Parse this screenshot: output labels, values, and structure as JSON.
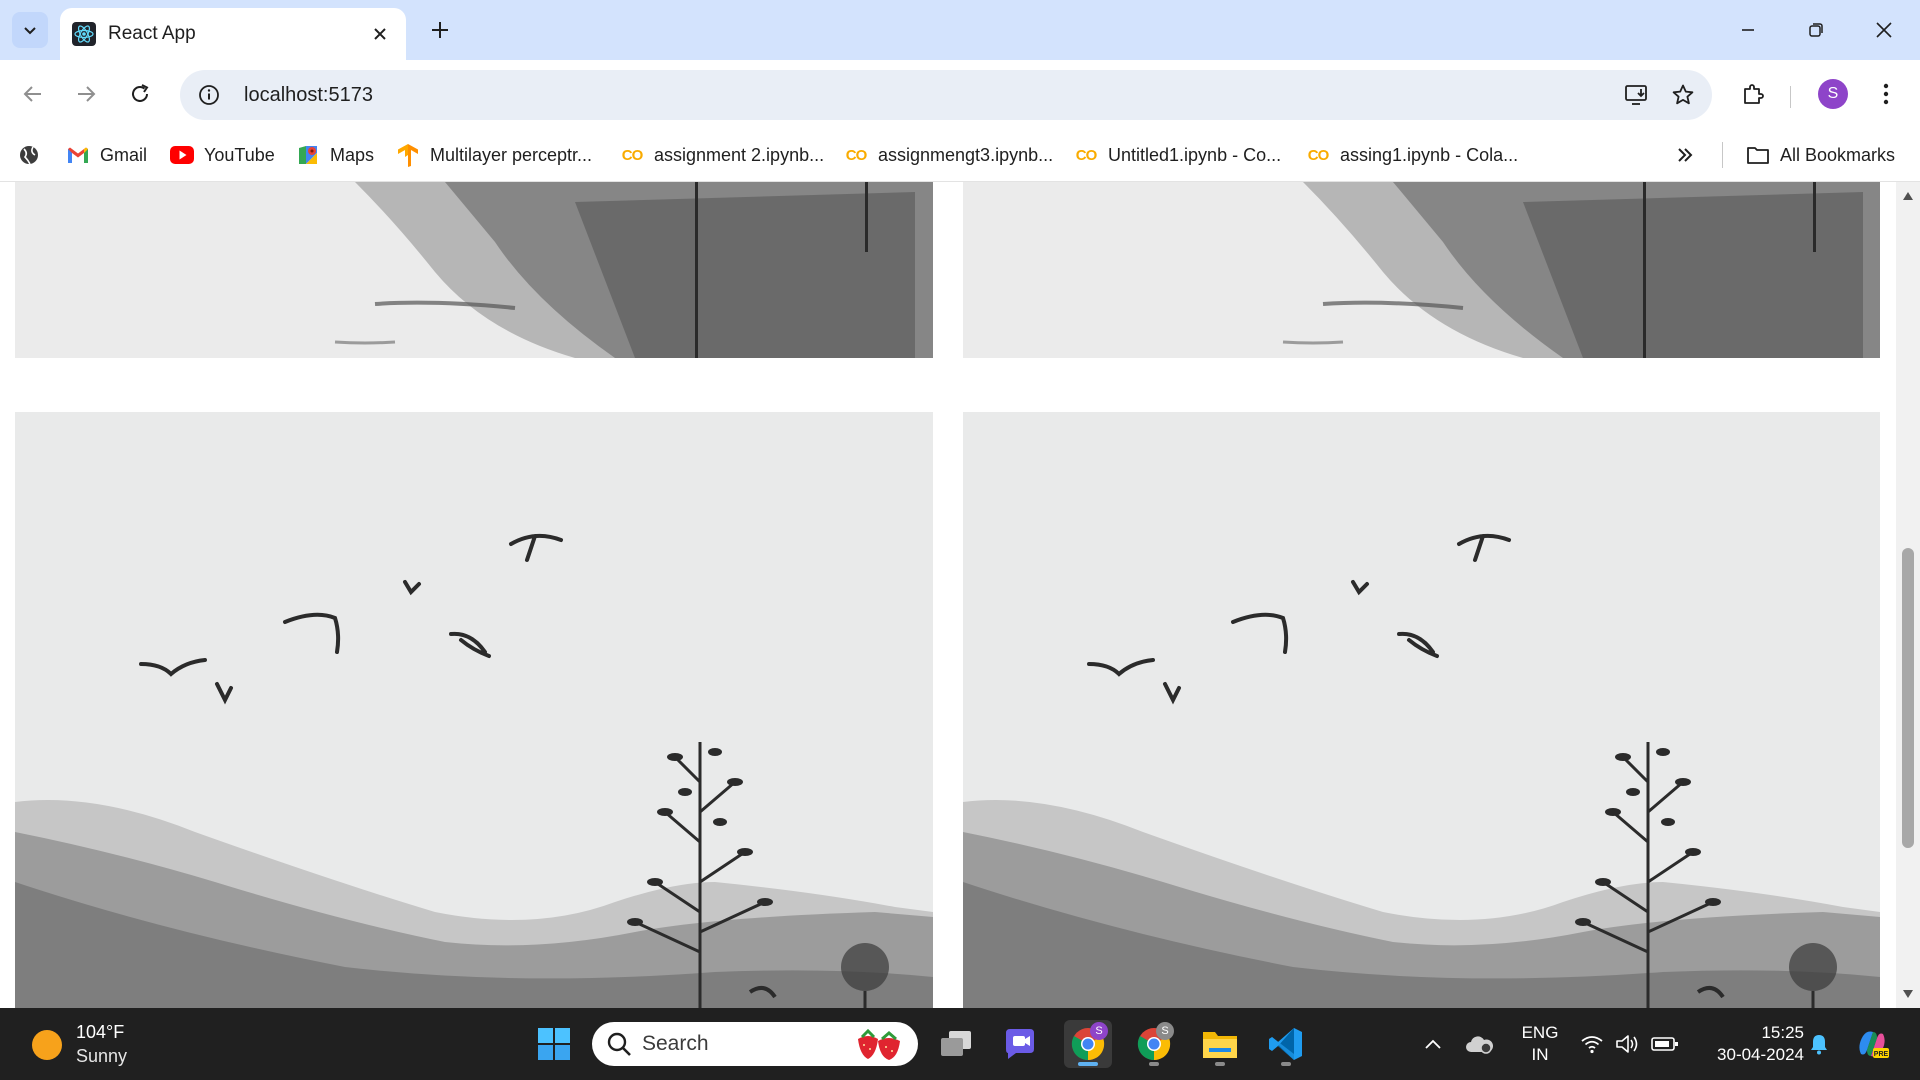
{
  "browser": {
    "tab": {
      "title": "React App",
      "favicon": "react-icon"
    },
    "address_bar": {
      "url": "localhost:5173"
    },
    "profile_initial": "S",
    "bookmarks": [
      {
        "label": "Gmail",
        "icon": "gmail-icon"
      },
      {
        "label": "YouTube",
        "icon": "youtube-icon"
      },
      {
        "label": "Maps",
        "icon": "maps-icon"
      },
      {
        "label": "Multilayer perceptr...",
        "icon": "tensorflow-icon"
      },
      {
        "label": "assignment 2.ipynb...",
        "icon": "colab-icon"
      },
      {
        "label": "assignmengt3.ipynb...",
        "icon": "colab-icon"
      },
      {
        "label": "Untitled1.ipynb - Co...",
        "icon": "colab-icon"
      },
      {
        "label": "assing1.ipynb - Cola...",
        "icon": "colab-icon"
      }
    ],
    "all_bookmarks_label": "All Bookmarks",
    "colab_glyph": "CO"
  },
  "page": {
    "images": [
      {
        "subject": "ink-wash landscape, bottom part"
      },
      {
        "subject": "ink-wash landscape, bottom part"
      },
      {
        "subject": "ink-wash landscape with flying birds, hills and tree"
      },
      {
        "subject": "ink-wash landscape with flying birds, hills and tree"
      }
    ]
  },
  "taskbar": {
    "weather": {
      "temp": "104°F",
      "condition": "Sunny"
    },
    "search_label": "Search",
    "language": {
      "line1": "ENG",
      "line2": "IN"
    },
    "clock": {
      "time": "15:25",
      "date": "30-04-2024"
    },
    "chrome_profile_badge_1": "S",
    "chrome_profile_badge_2": "S"
  },
  "colors": {
    "tabstrip_bg": "#d3e3fd",
    "omnibox_bg": "#e9eef6",
    "avatar_bg": "#8e44c9",
    "taskbar_bg": "#202020"
  }
}
